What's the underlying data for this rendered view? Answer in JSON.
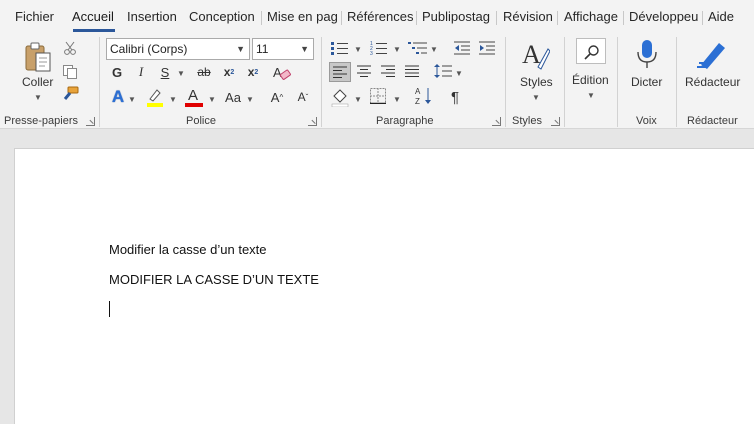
{
  "tabs": [
    {
      "label": "Fichier"
    },
    {
      "label": "Accueil"
    },
    {
      "label": "Insertion"
    },
    {
      "label": "Conception"
    },
    {
      "label": "Mise en pag"
    },
    {
      "label": "Références"
    },
    {
      "label": "Publipostag"
    },
    {
      "label": "Révision"
    },
    {
      "label": "Affichage"
    },
    {
      "label": "Développeu"
    },
    {
      "label": "Aide"
    }
  ],
  "ribbon": {
    "clipboard": {
      "label": "Presse-papiers",
      "paste_label": "Coller"
    },
    "font": {
      "label": "Police",
      "font_name": "Calibri (Corps)",
      "font_size": "11",
      "bold": "G",
      "italic": "I",
      "underline": "S",
      "strike": "ab",
      "subscript": "x",
      "superscript": "x",
      "effects": "A",
      "case": "Aa",
      "grow": "A",
      "shrink": "A"
    },
    "paragraph": {
      "label": "Paragraphe"
    },
    "styles": {
      "label": "Styles",
      "button": "Styles"
    },
    "editing": {
      "button": "Édition"
    },
    "voice": {
      "label": "Voix",
      "button": "Dicter"
    },
    "editor": {
      "label": "Rédacteur",
      "button": "Rédacteur"
    }
  },
  "document": {
    "line1": "Modifier la casse d’un texte",
    "line2": "MODIFIER LA CASSE D’UN TEXTE"
  },
  "colors": {
    "accent": "#2b579a",
    "highlight": "#ffff00",
    "font_color": "#e00000"
  }
}
